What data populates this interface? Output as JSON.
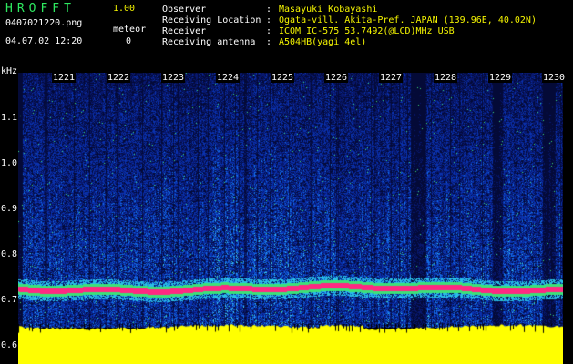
{
  "header": {
    "app_name": "HROFFT",
    "version": "1.00",
    "filename": "0407021220.png",
    "meteor_label": "meteor",
    "datetime": "04.07.02 12:20",
    "meteor_count": "0"
  },
  "info": {
    "observer_label": "Observer",
    "observer_value": "Masayuki Kobayashi",
    "location_label": "Receiving Location",
    "location_value": "Ogata-vill. Akita-Pref. JAPAN (139.96E, 40.02N)",
    "receiver_label": "Receiver",
    "receiver_value": "ICOM IC-575 53.7492(@LCD)MHz USB",
    "antenna_label": "Receiving antenna",
    "antenna_value": "A504HB(yagi 4el)",
    "colon": ":"
  },
  "axis": {
    "unit": "kHz",
    "y_ticks": [
      "1.1",
      "1.0",
      "0.9",
      "0.8",
      "0.7",
      "0.6"
    ],
    "x_ticks": [
      "1221",
      "1222",
      "1223",
      "1224",
      "1225",
      "1226",
      "1227",
      "1228",
      "1229",
      "1230"
    ]
  },
  "colors": {
    "background": "#000000",
    "noise_dark": "#0a1a6e",
    "noise_mid": "#1f4fd8",
    "noise_light": "#3fb0e8",
    "signal_green": "#40e070",
    "signal_peak": "#ff2a80",
    "floor_yellow": "#ffff00",
    "title_green": "#2ee860",
    "value_yellow": "#f5f500"
  }
}
